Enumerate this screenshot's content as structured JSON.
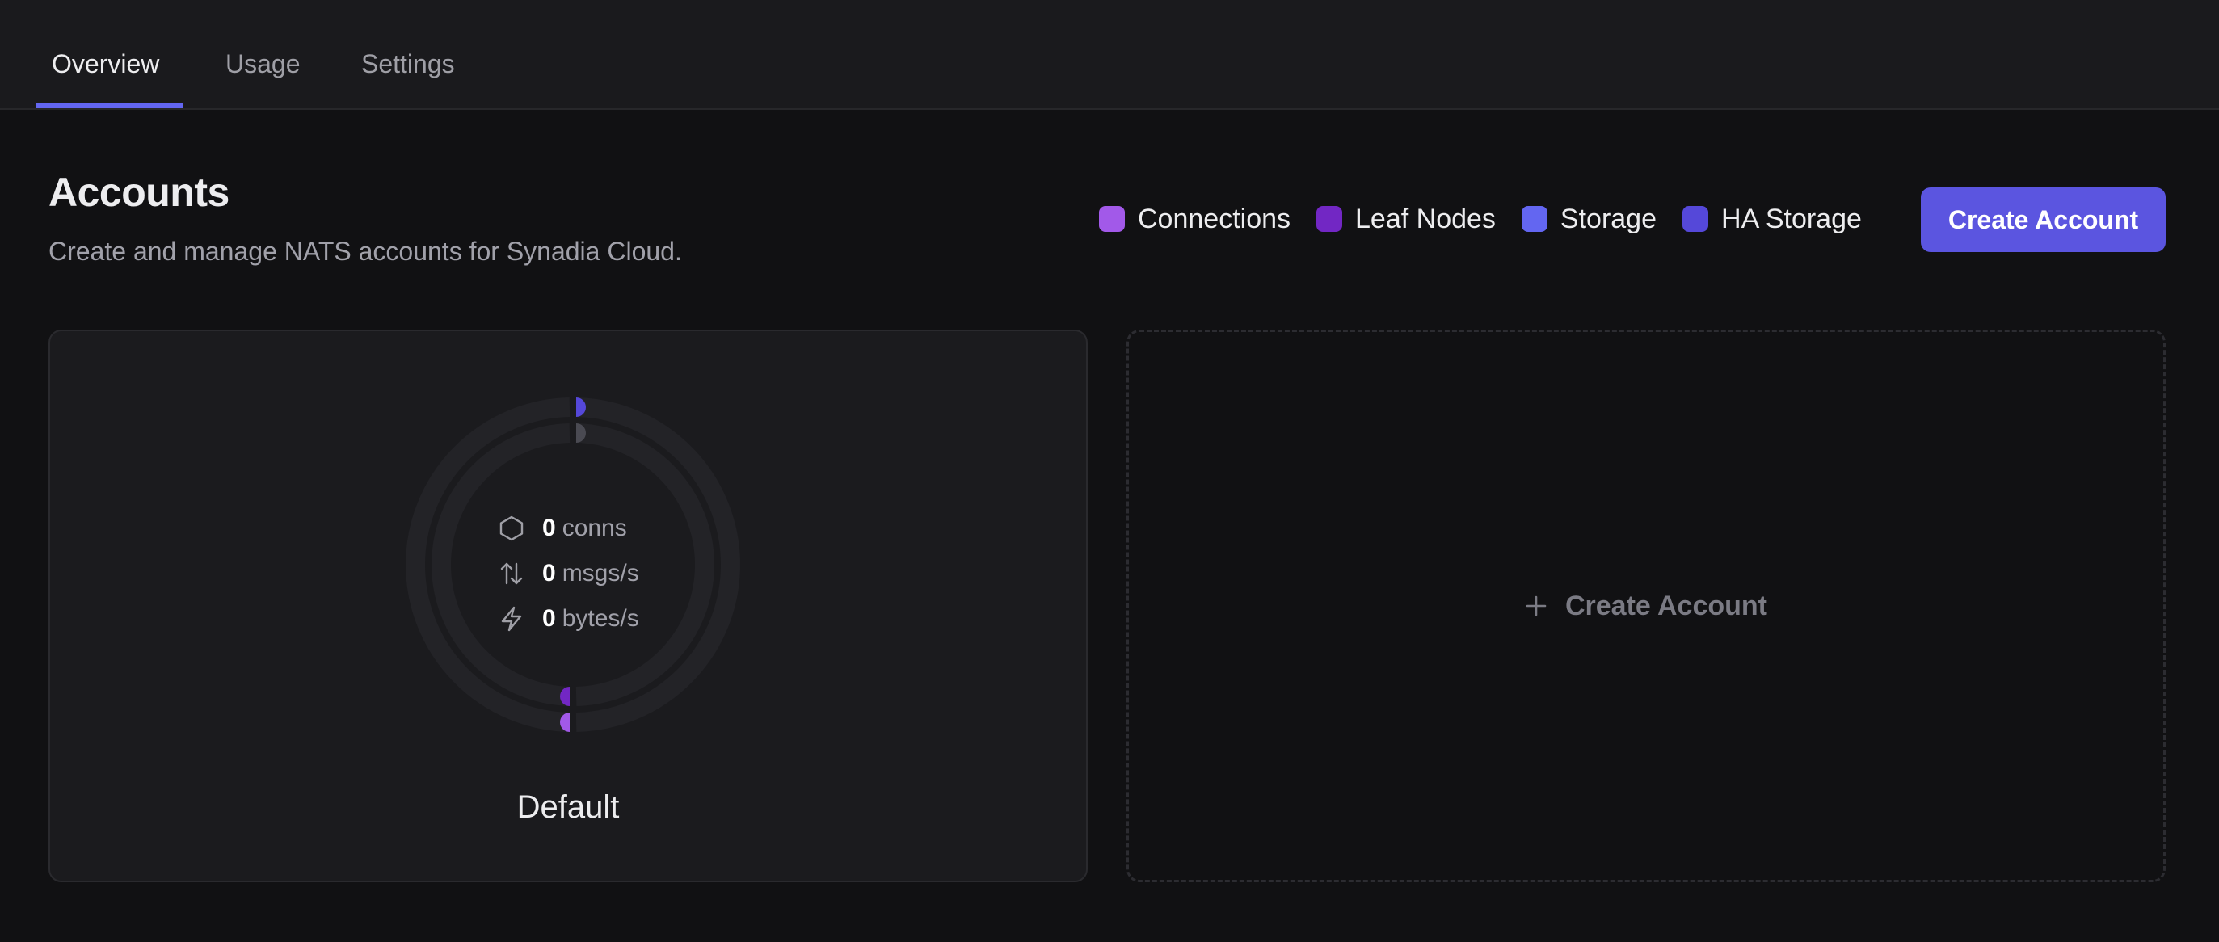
{
  "tabs": [
    {
      "label": "Overview",
      "active": true
    },
    {
      "label": "Usage",
      "active": false
    },
    {
      "label": "Settings",
      "active": false
    }
  ],
  "header": {
    "title": "Accounts",
    "subtitle": "Create and manage NATS accounts for Synadia Cloud."
  },
  "legend": [
    {
      "label": "Connections",
      "color": "#a259e9"
    },
    {
      "label": "Leaf Nodes",
      "color": "#7227c4"
    },
    {
      "label": "Storage",
      "color": "#6366f1"
    },
    {
      "label": "HA Storage",
      "color": "#5548d9"
    }
  ],
  "create_button": {
    "label": "Create Account"
  },
  "accounts": [
    {
      "name": "Default",
      "stats": [
        {
          "icon": "hexagon-icon",
          "value": "0",
          "unit": "conns"
        },
        {
          "icon": "arrows-up-down-icon",
          "value": "0",
          "unit": "msgs/s"
        },
        {
          "icon": "lightning-icon",
          "value": "0",
          "unit": "bytes/s"
        }
      ],
      "usage": {
        "connections": 0,
        "leaf_nodes": 0,
        "storage": 0,
        "ha_storage": 0
      }
    }
  ],
  "create_placeholder": {
    "label": "Create Account",
    "icon": "plus-icon"
  },
  "colors": {
    "accent": "#6366f1",
    "button": "#5b55e0",
    "ring_track": "#232327",
    "ring_inner_start": "#4a4a52"
  }
}
